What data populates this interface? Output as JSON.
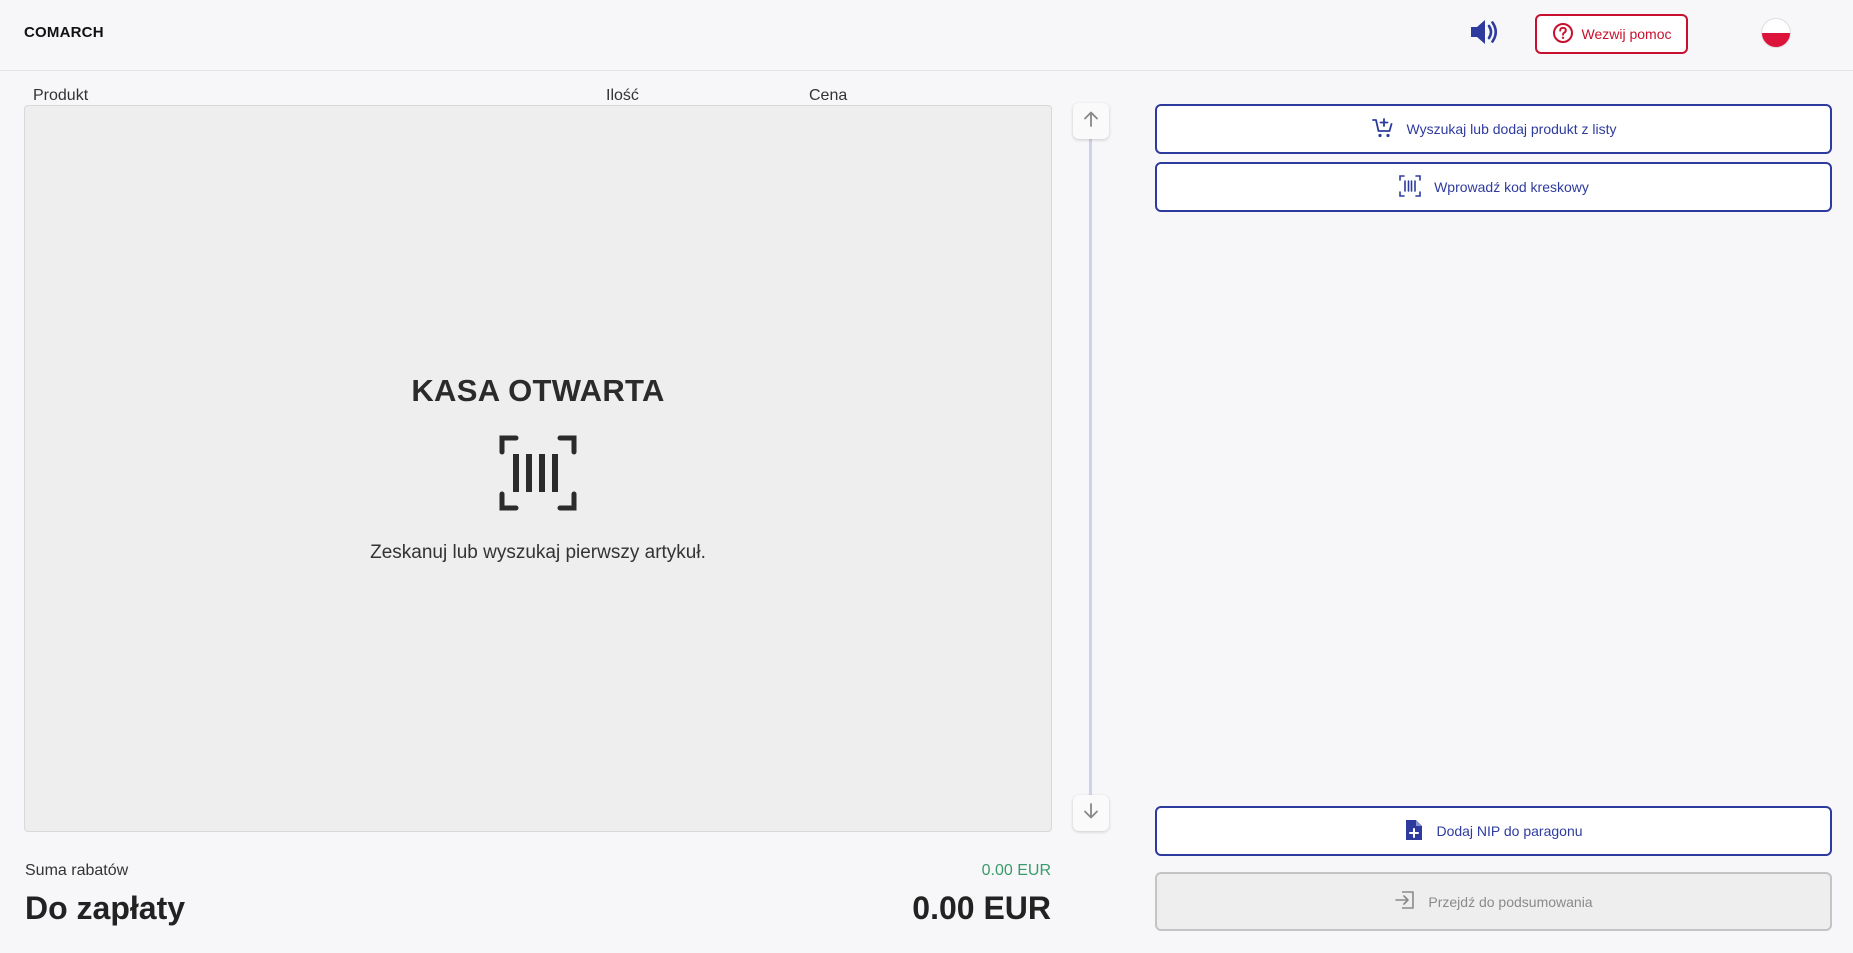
{
  "header": {
    "brand": "COMARCH",
    "help_button": "Wezwij pomoc",
    "sound_icon": "speaker-icon",
    "help_icon": "question-circle-icon",
    "language_flag": "poland-flag-icon"
  },
  "cart": {
    "columns": {
      "product": "Produkt",
      "quantity": "Ilość",
      "price": "Cena"
    },
    "empty_title": "KASA OTWARTA",
    "empty_icon": "barcode-scan-icon",
    "empty_message": "Zeskanuj lub wyszukaj pierwszy artykuł."
  },
  "actions": {
    "search_product": "Wyszukaj lub dodaj produkt z listy",
    "enter_barcode": "Wprowadź kod kreskowy",
    "add_nip": "Dodaj NIP do paragonu",
    "go_to_summary": "Przejdź do podsumowania"
  },
  "summary": {
    "discount_label": "Suma rabatów",
    "discount_value": "0.00 EUR",
    "to_pay_label": "Do zapłaty",
    "to_pay_value": "0.00 EUR"
  },
  "colors": {
    "accent": "#2e3b9e",
    "danger": "#c8102e",
    "discount": "#3a9b6a"
  }
}
